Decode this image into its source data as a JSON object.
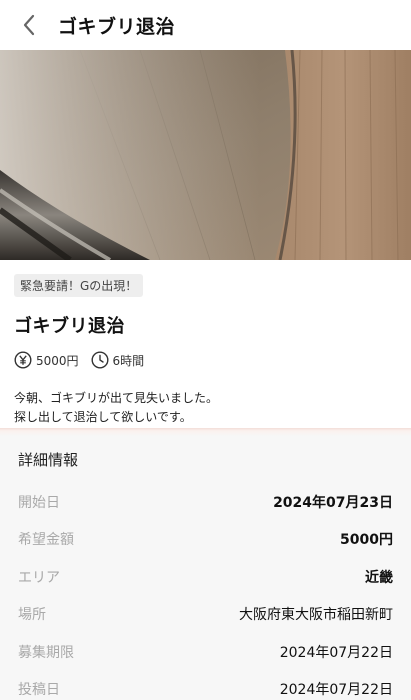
{
  "header": {
    "title": "ゴキブリ退治"
  },
  "summary": {
    "tag": "緊急要請！Gの出現！",
    "title": "ゴキブリ退治",
    "reward": "5000円",
    "duration": "6時間",
    "description_line1": "今朝、ゴキブリが出て見失いました。",
    "description_line2": "探し出して退治して欲しいです。"
  },
  "details": {
    "heading": "詳細情報",
    "rows": [
      {
        "label": "開始日",
        "value": "2024年07月23日"
      },
      {
        "label": "希望金額",
        "value": "5000円"
      },
      {
        "label": "エリア",
        "value": "近畿"
      },
      {
        "label": "場所",
        "value": "大阪府東大阪市稲田新町"
      },
      {
        "label": "募集期限",
        "value": "2024年07月22日"
      },
      {
        "label": "投稿日",
        "value": "2024年07月22日"
      }
    ]
  },
  "icons": {
    "back": "chevron-left-icon",
    "reward": "yen-icon",
    "duration": "clock-icon"
  },
  "colors": {
    "accent_divider": "#f3ded8",
    "label_gray": "#a9a9a9",
    "details_bg": "#f7f7f7"
  }
}
